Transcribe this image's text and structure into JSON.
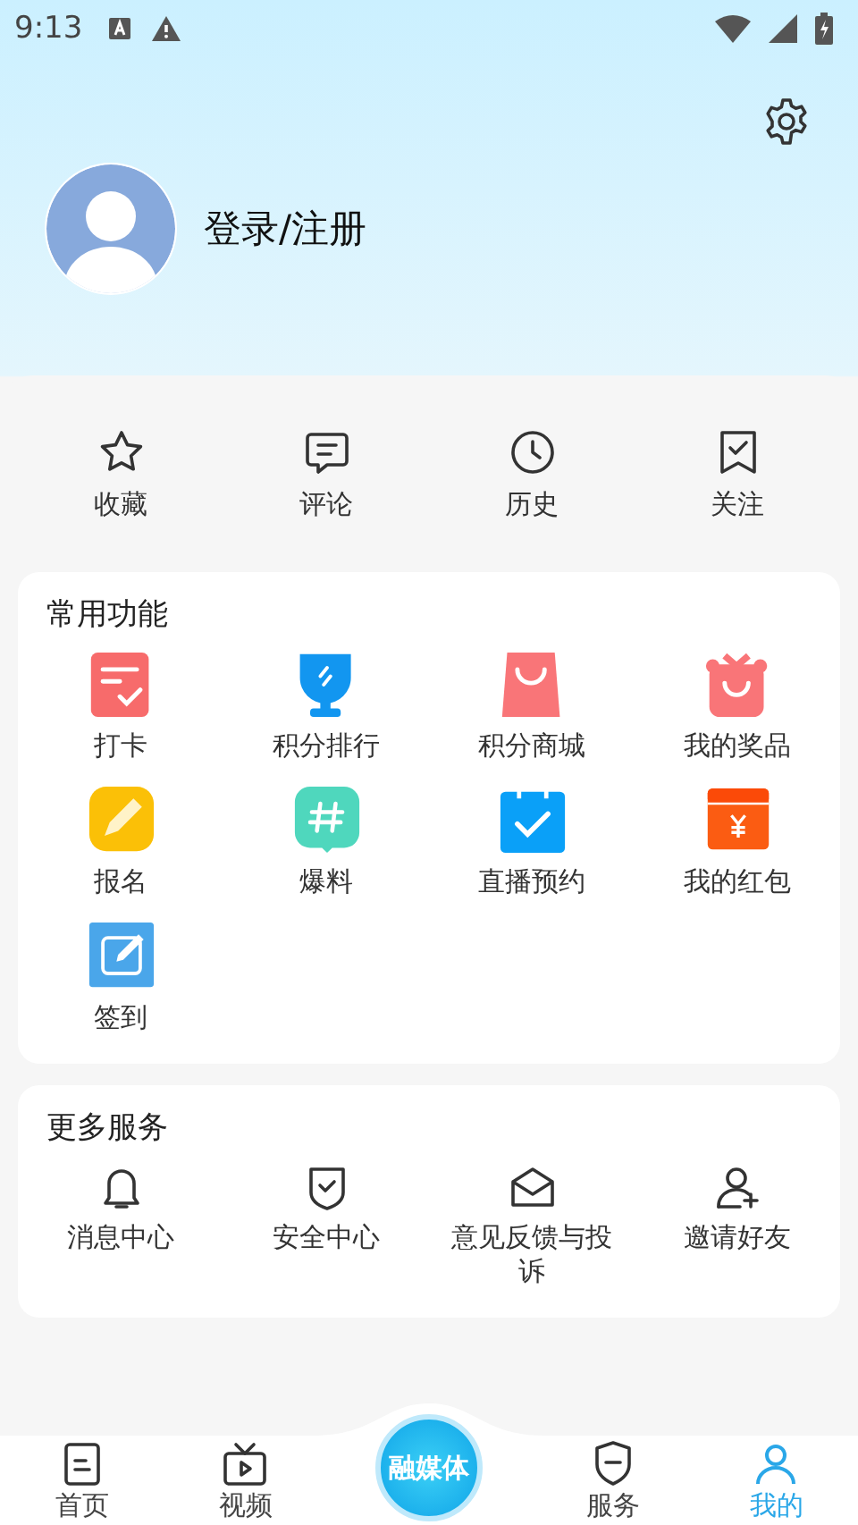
{
  "status_bar": {
    "time": "9:13"
  },
  "profile": {
    "login": "登录/注册"
  },
  "quick_actions": [
    {
      "label": "收藏"
    },
    {
      "label": "评论"
    },
    {
      "label": "历史"
    },
    {
      "label": "关注"
    }
  ],
  "sections": [
    {
      "title": "常用功能",
      "items": [
        {
          "label": "打卡"
        },
        {
          "label": "积分排行"
        },
        {
          "label": "积分商城"
        },
        {
          "label": "我的奖品"
        },
        {
          "label": "报名"
        },
        {
          "label": "爆料"
        },
        {
          "label": "直播预约"
        },
        {
          "label": "我的红包"
        },
        {
          "label": "签到"
        }
      ]
    },
    {
      "title": "更多服务",
      "items": [
        {
          "label": "消息中心"
        },
        {
          "label": "安全中心"
        },
        {
          "label": "意见反馈与投诉"
        },
        {
          "label": "邀请好友"
        }
      ]
    }
  ],
  "tab_bar": [
    {
      "kind": "tab",
      "label": "首页",
      "selected": false
    },
    {
      "kind": "tab",
      "label": "视频",
      "selected": false
    },
    {
      "kind": "center",
      "label": "融媒体"
    },
    {
      "kind": "tab",
      "label": "服务",
      "selected": false
    },
    {
      "kind": "tab",
      "label": "我的",
      "selected": true
    }
  ]
}
